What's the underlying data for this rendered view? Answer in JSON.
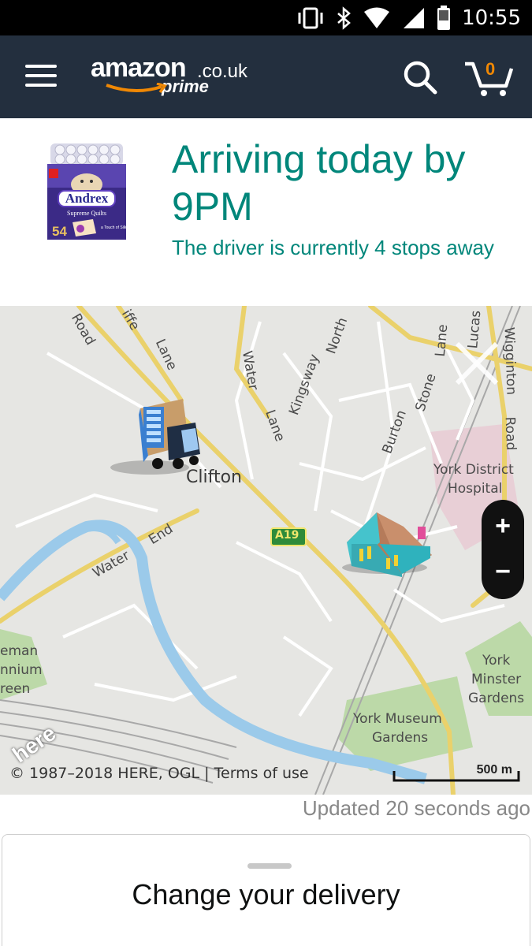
{
  "status_bar": {
    "time": "10:55",
    "icons": [
      "vibrate-icon",
      "bluetooth-icon",
      "wifi-icon",
      "signal-icon",
      "battery-icon"
    ]
  },
  "header": {
    "logo": {
      "brand": "amazon",
      "tld": ".co.uk",
      "tier": "prime"
    },
    "cart_count": "0",
    "colors": {
      "background": "#232f3e",
      "accent": "#f08804"
    }
  },
  "product": {
    "brand": "Andrex",
    "subtitle": "Supreme Quilts",
    "pack_count": "54",
    "tagline": "a Touch of Silk"
  },
  "delivery": {
    "title": "Arriving today by 9PM",
    "driver_status": "The driver is currently 4 stops away",
    "color": "#00867a"
  },
  "map": {
    "places": {
      "clifton": "Clifton",
      "york_district": "York District",
      "hospital": "Hospital",
      "york_minster": "York",
      "minster_line2": "Minster",
      "minster_line3": "Gardens",
      "york_museum": "York Museum",
      "museum_line2": "Gardens",
      "left_edge_1": "eman",
      "left_edge_2": "nnium",
      "left_edge_3": "reen"
    },
    "roads": {
      "road_nw": "Road",
      "cliffe_a": "iffe",
      "cliffe_b": "Lane",
      "water_lane_a": "Water",
      "water_lane_b": "Lane",
      "kingsway": "Kingsway",
      "north": "North",
      "burton": "Burton",
      "stone": "Stone",
      "lane_a": "Lane",
      "lucas": "Lucas",
      "wigginton": "Wigginton",
      "road_e": "Road",
      "water_end_a": "Water",
      "water_end_b": "End",
      "a19": "A19"
    },
    "copyright": "© 1987–2018 HERE, OGL |",
    "terms": "Terms of use",
    "scale": "500 m",
    "provider": "here",
    "zoom_in": "+",
    "zoom_out": "−"
  },
  "updated_text": "Updated 20 seconds ago",
  "change_delivery": "Change your delivery"
}
